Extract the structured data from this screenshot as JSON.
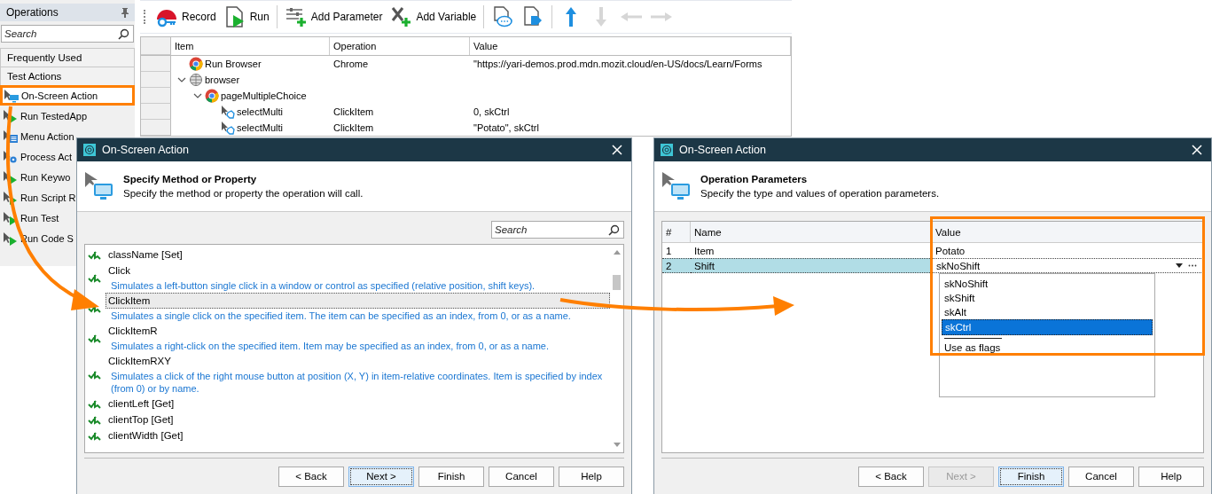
{
  "sidebar": {
    "title": "Operations",
    "search": {
      "placeholder": "Search"
    },
    "categories": [
      {
        "label": "Frequently Used"
      },
      {
        "label": "Test Actions"
      }
    ],
    "items": [
      {
        "label": "On-Screen Action",
        "kind": "onscreen",
        "selected": true
      },
      {
        "label": "Run TestedApp",
        "kind": "app",
        "selected": false
      },
      {
        "label": "Menu Action",
        "kind": "menu",
        "selected": false
      },
      {
        "label": "Process Act",
        "kind": "process",
        "selected": false
      },
      {
        "label": "Run Keywo",
        "kind": "keyword",
        "selected": false
      },
      {
        "label": "Run Script R",
        "kind": "script",
        "selected": false
      },
      {
        "label": "Run Test",
        "kind": "test",
        "selected": false
      },
      {
        "label": "Run Code S",
        "kind": "code",
        "selected": false
      }
    ]
  },
  "toolbar": [
    [
      {
        "label": "Record",
        "kind": "record",
        "disabled": false
      },
      {
        "label": "Run",
        "kind": "run",
        "disabled": false
      }
    ],
    [
      {
        "label": "Add Parameter",
        "kind": "param",
        "disabled": false
      },
      {
        "label": "Add Variable",
        "kind": "variable",
        "disabled": false
      }
    ],
    [
      {
        "kind": "comment",
        "disabled": false
      },
      {
        "kind": "tag",
        "disabled": false
      }
    ],
    [
      {
        "kind": "up",
        "disabled": false
      },
      {
        "kind": "down",
        "disabled": true
      },
      {
        "kind": "left",
        "disabled": true
      },
      {
        "kind": "right",
        "disabled": true
      }
    ]
  ],
  "table": {
    "columns": [
      "Item",
      "Operation",
      "Value"
    ],
    "rows": [
      {
        "item": "Run Browser",
        "kind": "chrome",
        "operation": "Chrome",
        "value": "\"https://yari-demos.prod.mdn.mozit.cloud/en-US/docs/Learn/Forms"
      },
      {
        "item": "browser",
        "kind": "globe",
        "expanded": true,
        "children": [
          {
            "item": "pageMultipleChoice",
            "kind": "chrome",
            "expanded": true,
            "children": [
              {
                "item": "selectMulti",
                "kind": "onscreen",
                "operation": "ClickItem",
                "value": "0, skCtrl"
              },
              {
                "item": "selectMulti",
                "kind": "onscreen",
                "operation": "ClickItem",
                "value": "\"Potato\", skCtrl"
              }
            ]
          }
        ]
      }
    ]
  },
  "method_dialog": {
    "title": "On-Screen Action",
    "heading": "Specify Method or Property",
    "subheading": "Specify the method or property the operation will call.",
    "search": {
      "placeholder": "Search"
    },
    "methods": [
      {
        "name": "className [Set]",
        "selected": false
      },
      {
        "name": "Click",
        "description": "Simulates a left-button single click in a window or control as specified (relative position, shift keys).",
        "selected": false
      },
      {
        "name": "ClickItem",
        "description": "Simulates a single click on the specified item. The item can be specified as an index, from 0, or as a name.",
        "selected": true
      },
      {
        "name": "ClickItemR",
        "description": "Simulates a right-click on the specified item. Item may be specified as an index, from 0, or as a name.",
        "selected": false
      },
      {
        "name": "ClickItemRXY",
        "description": "Simulates a click of the right mouse button at position (X, Y) in item-relative coordinates. Item is specified by index (from 0) or by name.",
        "selected": false
      },
      {
        "name": "clientLeft [Get]",
        "selected": false
      },
      {
        "name": "clientTop [Get]",
        "selected": false
      },
      {
        "name": "clientWidth [Get]",
        "selected": false
      }
    ],
    "buttons": [
      {
        "label": "< Back",
        "disabled": false,
        "focused": false
      },
      {
        "label": "Next >",
        "disabled": false,
        "focused": true
      },
      {
        "label": "Finish",
        "disabled": false,
        "focused": false
      },
      {
        "label": "Cancel",
        "disabled": false,
        "focused": false
      },
      {
        "label": "Help",
        "disabled": false,
        "focused": false
      }
    ]
  },
  "params_dialog": {
    "title": "On-Screen Action",
    "heading": "Operation Parameters",
    "subheading": "Specify the type and values of operation parameters.",
    "columns": [
      "#",
      "Name",
      "Value"
    ],
    "rows": [
      {
        "number": "1",
        "name": "Item",
        "value": "Potato",
        "selected": false
      },
      {
        "number": "2",
        "name": "Shift",
        "value": "skNoShift",
        "selected": true
      }
    ],
    "dropdown": {
      "options": [
        {
          "label": "skNoShift",
          "selected": false
        },
        {
          "label": "skShift",
          "selected": false
        },
        {
          "label": "skAlt",
          "selected": false
        },
        {
          "label": "skCtrl",
          "selected": true
        }
      ],
      "flags_label": "Use as flags"
    },
    "buttons": [
      {
        "label": "< Back",
        "disabled": false,
        "focused": false
      },
      {
        "label": "Next >",
        "disabled": true,
        "focused": false
      },
      {
        "label": "Finish",
        "disabled": false,
        "focused": true
      },
      {
        "label": "Cancel",
        "disabled": false,
        "focused": false
      },
      {
        "label": "Help",
        "disabled": false,
        "focused": false
      }
    ]
  }
}
